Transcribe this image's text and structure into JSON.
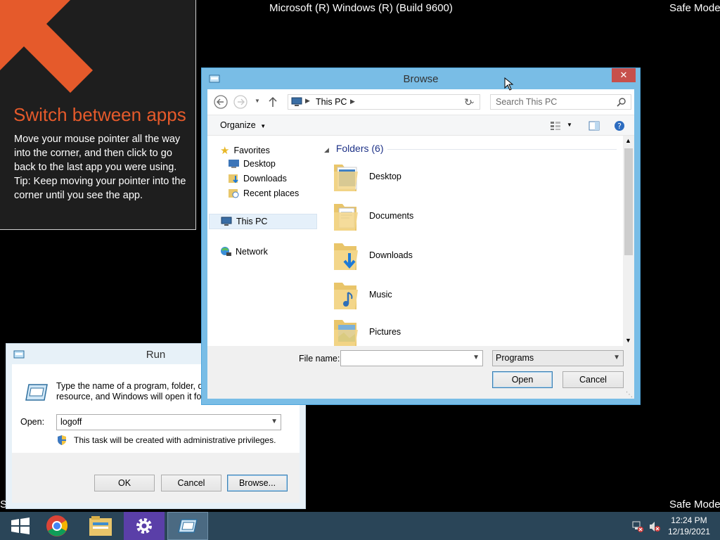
{
  "desktop": {
    "os_label": "Microsoft (R) Windows (R) (Build 9600)",
    "safe_mode_top": "Safe Mode",
    "safe_mode_bottom": "Safe Mode",
    "safe_mode_left_partial": "S"
  },
  "hint": {
    "title": "Switch between apps",
    "body": "Move your mouse pointer all the way into the corner, and then click to go back to the last app you were using.",
    "tip": "Tip: Keep moving your pointer into the corner until you see the app."
  },
  "run": {
    "title": "Run",
    "description_line1": "Type the name of a program, folder, do",
    "description_line2": "resource, and Windows will open it for y",
    "open_label": "Open:",
    "open_value": "logoff",
    "admin_note": "This task will be created with administrative privileges.",
    "ok": "OK",
    "cancel": "Cancel",
    "browse": "Browse..."
  },
  "browse": {
    "title": "Browse",
    "address": "This PC",
    "search_placeholder": "Search This PC",
    "organize": "Organize",
    "nav": {
      "favorites": "Favorites",
      "desktop": "Desktop",
      "downloads": "Downloads",
      "recent": "Recent places",
      "this_pc": "This PC",
      "network": "Network"
    },
    "group_header": "Folders (6)",
    "folders": [
      "Desktop",
      "Documents",
      "Downloads",
      "Music",
      "Pictures"
    ],
    "file_name_label": "File name:",
    "file_name_value": "",
    "file_type": "Programs",
    "open": "Open",
    "cancel": "Cancel"
  },
  "taskbar": {
    "time": "12:24 PM",
    "date": "12/19/2021"
  },
  "colors": {
    "hint_title": "#e55a2b",
    "arrow": "#e55a2b",
    "taskbar": "#2a4558",
    "window_frame": "#79bde6",
    "close": "#c7504c"
  }
}
